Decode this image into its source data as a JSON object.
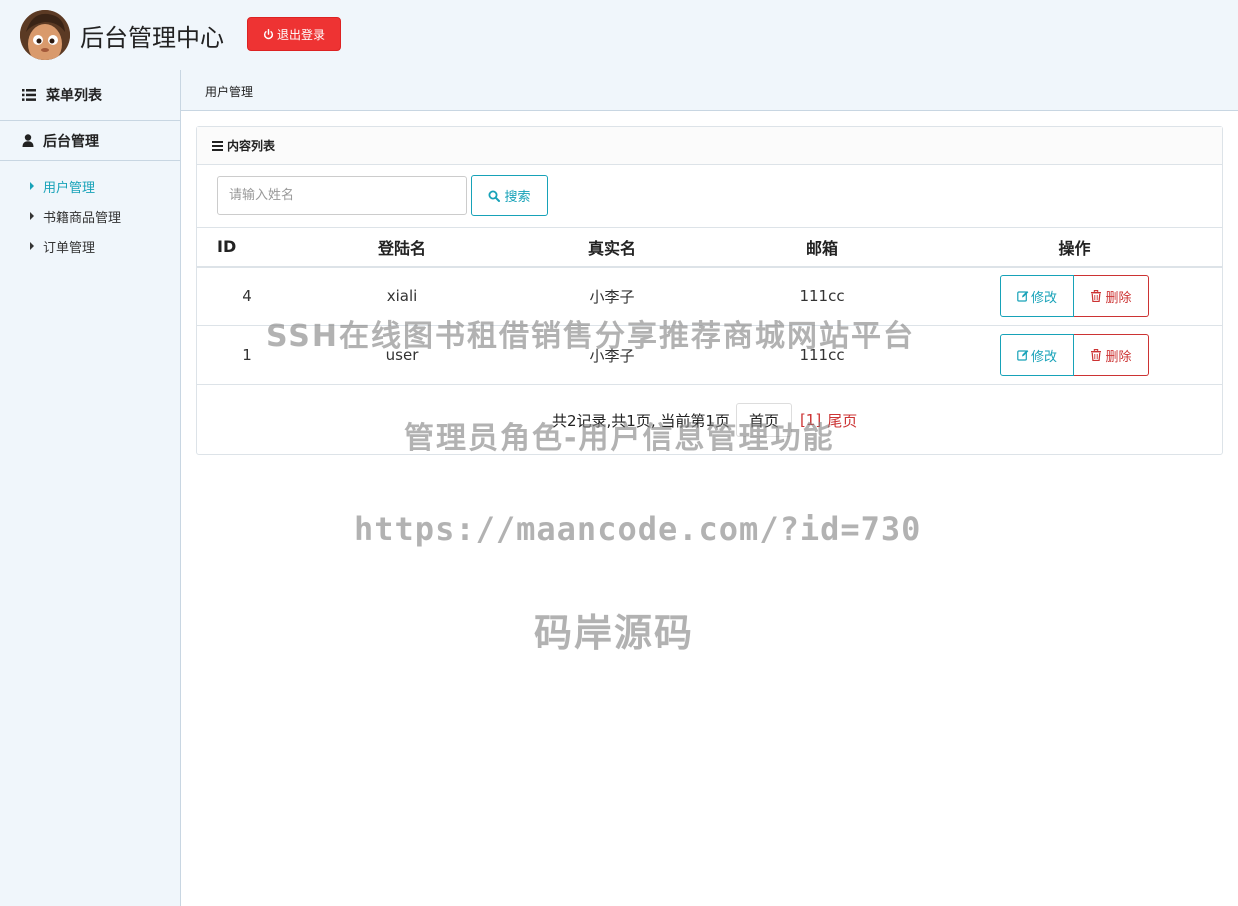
{
  "header": {
    "title": "后台管理中心",
    "logout_label": "退出登录"
  },
  "sidebar": {
    "menu_title": "菜单列表",
    "group_title": "后台管理",
    "items": [
      {
        "label": "用户管理",
        "active": true
      },
      {
        "label": "书籍商品管理",
        "active": false
      },
      {
        "label": "订单管理",
        "active": false
      }
    ]
  },
  "breadcrumb": "用户管理",
  "panel": {
    "title": "内容列表",
    "search": {
      "placeholder": "请输入姓名",
      "button_label": "搜索"
    },
    "columns": [
      "ID",
      "登陆名",
      "真实名",
      "邮箱",
      "操作"
    ],
    "rows": [
      {
        "id": "4",
        "login": "xiali",
        "real_name": "小李子",
        "email": "111cc"
      },
      {
        "id": "1",
        "login": "user",
        "real_name": "小李子",
        "email": "111cc"
      }
    ],
    "edit_label": "修改",
    "delete_label": "删除",
    "pagination": {
      "summary": "共2记录,共1页, 当前第1页",
      "first_label": "首页",
      "current": "[1]",
      "last_label": "尾页"
    }
  },
  "watermark": {
    "line1": "SSH在线图书租借销售分享推荐商城网站平台",
    "line2": "管理员角色-用户信息管理功能",
    "line3": "https://maancode.com/?id=730",
    "line4": "码岸源码"
  },
  "colors": {
    "accent": "#17a2b8",
    "danger": "#ee3333",
    "background": "#f0f6fb"
  }
}
